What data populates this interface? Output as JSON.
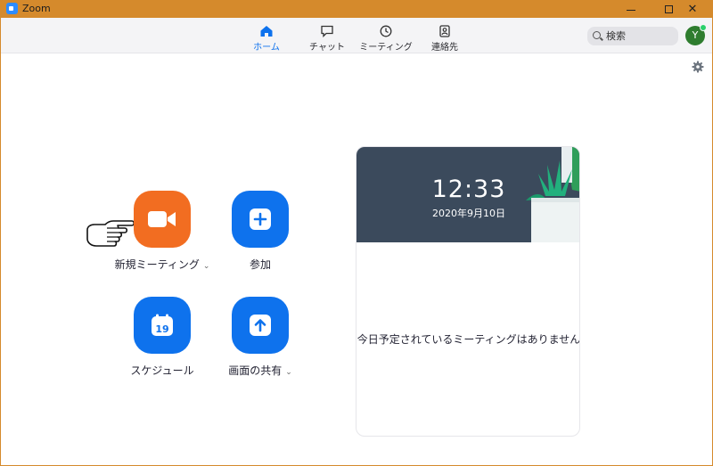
{
  "window": {
    "title": "Zoom"
  },
  "nav": {
    "tabs": [
      {
        "label": "ホーム",
        "icon": "home-icon",
        "active": true
      },
      {
        "label": "チャット",
        "icon": "chat-bubble-icon",
        "active": false
      },
      {
        "label": "ミーティング",
        "icon": "clock-icon",
        "active": false
      },
      {
        "label": "連絡先",
        "icon": "contact-card-icon",
        "active": false
      }
    ],
    "search_label": "検索",
    "avatar_initial": "Y"
  },
  "actions": {
    "new_meeting": "新規ミーティング",
    "join": "参加",
    "schedule": "スケジュール",
    "schedule_day": "19",
    "share_screen": "画面の共有"
  },
  "card": {
    "time": "12:33",
    "date": "2020年9月10日",
    "empty_message": "今日予定されているミーティングはありません"
  },
  "colors": {
    "accent_blue": "#0e72ed",
    "accent_orange": "#f26d21",
    "titlebar": "#d58a2c",
    "card_header": "#3b4a5c"
  }
}
